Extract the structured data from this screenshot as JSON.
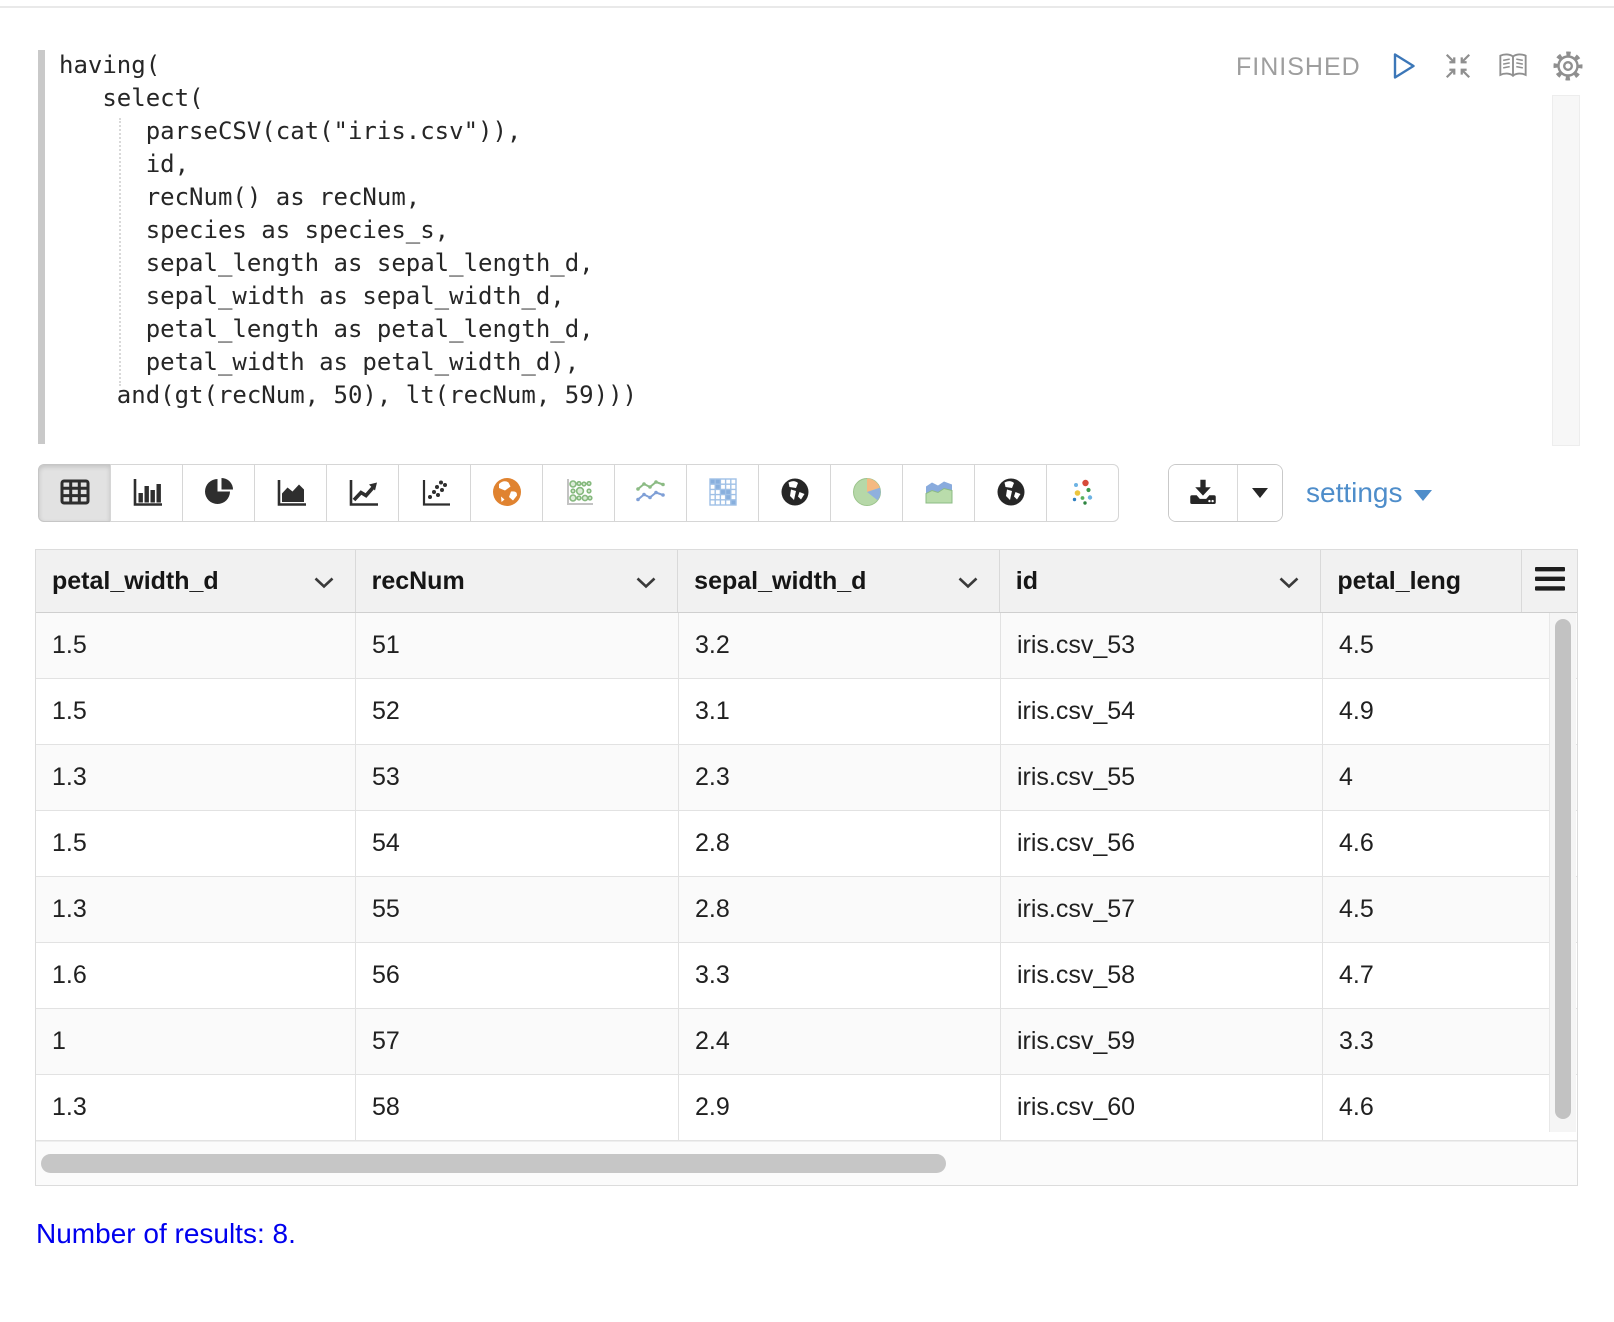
{
  "paragraph": {
    "status_label": "FINISHED",
    "controls": [
      "play-icon",
      "compress-icon",
      "book-icon",
      "gear-icon"
    ],
    "code": "having(\n   select(\n      parseCSV(cat(\"iris.csv\")),\n      id,\n      recNum() as recNum,\n      species as species_s,\n      sepal_length as sepal_length_d,\n      sepal_width as sepal_width_d,\n      petal_length as petal_length_d,\n      petal_width as petal_width_d),\n    and(gt(recNum, 50), lt(recNum, 59)))"
  },
  "toolbar": {
    "chart_types": [
      "table",
      "bar-chart",
      "pie-chart",
      "area-chart",
      "line-chart",
      "scatter-chart",
      "map-globe-orange",
      "bubble-grid",
      "multi-line-chart",
      "heatmap",
      "globe-dark",
      "pie-chart-colored",
      "stacked-area-colored",
      "globe-dark-2",
      "scatter-colored"
    ],
    "selected_chart": "table",
    "settings_label": "settings",
    "download_icon": "download-icon"
  },
  "table": {
    "columns": [
      "petal_width_d",
      "recNum",
      "sepal_width_d",
      "id",
      "petal_leng"
    ],
    "rows": [
      [
        "1.5",
        "51",
        "3.2",
        "iris.csv_53",
        "4.5"
      ],
      [
        "1.5",
        "52",
        "3.1",
        "iris.csv_54",
        "4.9"
      ],
      [
        "1.3",
        "53",
        "2.3",
        "iris.csv_55",
        "4"
      ],
      [
        "1.5",
        "54",
        "2.8",
        "iris.csv_56",
        "4.6"
      ],
      [
        "1.3",
        "55",
        "2.8",
        "iris.csv_57",
        "4.5"
      ],
      [
        "1.6",
        "56",
        "3.3",
        "iris.csv_58",
        "4.7"
      ],
      [
        "1",
        "57",
        "2.4",
        "iris.csv_59",
        "3.3"
      ],
      [
        "1.3",
        "58",
        "2.9",
        "iris.csv_60",
        "4.6"
      ]
    ]
  },
  "footer": {
    "results_label": "Number of results: 8."
  },
  "colors": {
    "settings_blue": "#4e8dca",
    "results_blue": "#0000ee",
    "status_gray": "#9e9e9e",
    "selected_button_bg": "#e2e2e2",
    "orange_globe": "#e08330"
  }
}
